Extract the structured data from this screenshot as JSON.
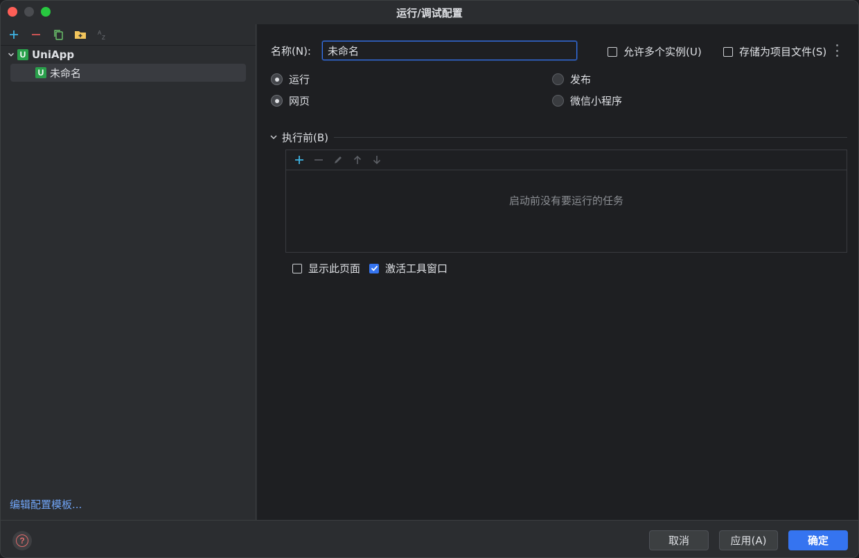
{
  "window": {
    "title": "运行/调试配置"
  },
  "colors": {
    "accent": "#3574f0",
    "link": "#6fa3f4",
    "badge": "#2aa04b"
  },
  "sidebar": {
    "toolbar_icons": [
      "add-icon",
      "remove-icon",
      "copy-icon",
      "new-folder-icon",
      "sort-az-icon"
    ],
    "tree": {
      "parent": {
        "label": "UniApp",
        "badge": "U",
        "expanded": true
      },
      "child": {
        "label": "未命名",
        "badge": "U",
        "selected": true
      }
    },
    "edit_templates_link": "编辑配置模板..."
  },
  "form": {
    "name_label": "名称(N):",
    "name_value": "未命名",
    "allow_multiple_label": "允许多个实例(U)",
    "allow_multiple_checked": false,
    "store_as_project_label": "存储为项目文件(S)",
    "store_as_project_checked": false,
    "radio_group_1": {
      "option_a": "运行",
      "option_b": "发布",
      "selected": "运行"
    },
    "radio_group_2": {
      "option_a": "网页",
      "option_b": "微信小程序",
      "selected": "网页"
    }
  },
  "before_launch": {
    "section_title": "执行前(B)",
    "empty_text": "启动前没有要运行的任务",
    "toolbar_icons": [
      "add-icon",
      "remove-icon",
      "edit-icon",
      "move-up-icon",
      "move-down-icon"
    ],
    "show_page_label": "显示此页面",
    "show_page_checked": false,
    "activate_tool_window_label": "激活工具窗口",
    "activate_tool_window_checked": true
  },
  "footer": {
    "cancel_label": "取消",
    "apply_label": "应用(A)",
    "ok_label": "确定"
  }
}
